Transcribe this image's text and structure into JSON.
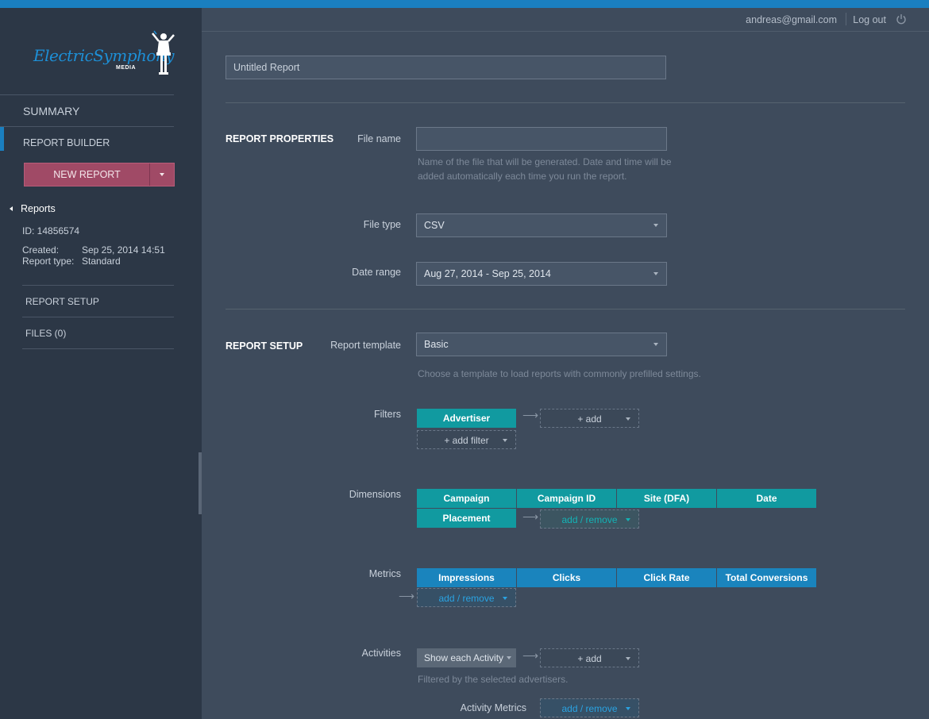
{
  "brand": {
    "logo_text": "ElectricSymphony",
    "logo_sub": "MEDIA"
  },
  "user": {
    "email": "andreas@gmail.com",
    "logout": "Log out"
  },
  "sidebar": {
    "summary": "SUMMARY",
    "report_builder": "REPORT BUILDER",
    "new_report": "NEW REPORT",
    "reports": "Reports",
    "id": "ID: 14856574",
    "created_label": "Created:",
    "created_value": "Sep 25, 2014 14:51",
    "type_label": "Report type:",
    "type_value": "Standard",
    "report_setup": "REPORT SETUP",
    "files": "FILES (0)"
  },
  "report": {
    "title_value": "Untitled Report"
  },
  "properties": {
    "section": "REPORT PROPERTIES",
    "file_name_label": "File name",
    "file_name_value": "",
    "file_name_help": "Name of the file that will be generated. Date and time will be added automatically each time you run the report.",
    "file_type_label": "File type",
    "file_type_value": "CSV",
    "date_range_label": "Date range",
    "date_range_value": "Aug 27, 2014 - Sep 25, 2014"
  },
  "setup": {
    "section": "REPORT SETUP",
    "template_label": "Report template",
    "template_value": "Basic",
    "template_help": "Choose a template to load reports with commonly prefilled settings.",
    "filters_label": "Filters",
    "filters": [
      "Advertiser"
    ],
    "filter_add": "+ add",
    "add_filter": "+ add filter",
    "dimensions_label": "Dimensions",
    "dimensions": [
      "Campaign",
      "Campaign ID",
      "Site (DFA)",
      "Date",
      "Placement"
    ],
    "add_remove": "add / remove",
    "metrics_label": "Metrics",
    "metrics": [
      "Impressions",
      "Clicks",
      "Click Rate",
      "Total Conversions"
    ],
    "activities_label": "Activities",
    "activities_value": "Show each Activity",
    "activities_add": "+ add",
    "activities_help": "Filtered by the selected advertisers.",
    "activity_metrics_label": "Activity Metrics"
  },
  "colors": {
    "accent": "#1a7fc0",
    "teal": "#119aa0",
    "metric_blue": "#1a84bd",
    "new_report": "#a04a66"
  }
}
